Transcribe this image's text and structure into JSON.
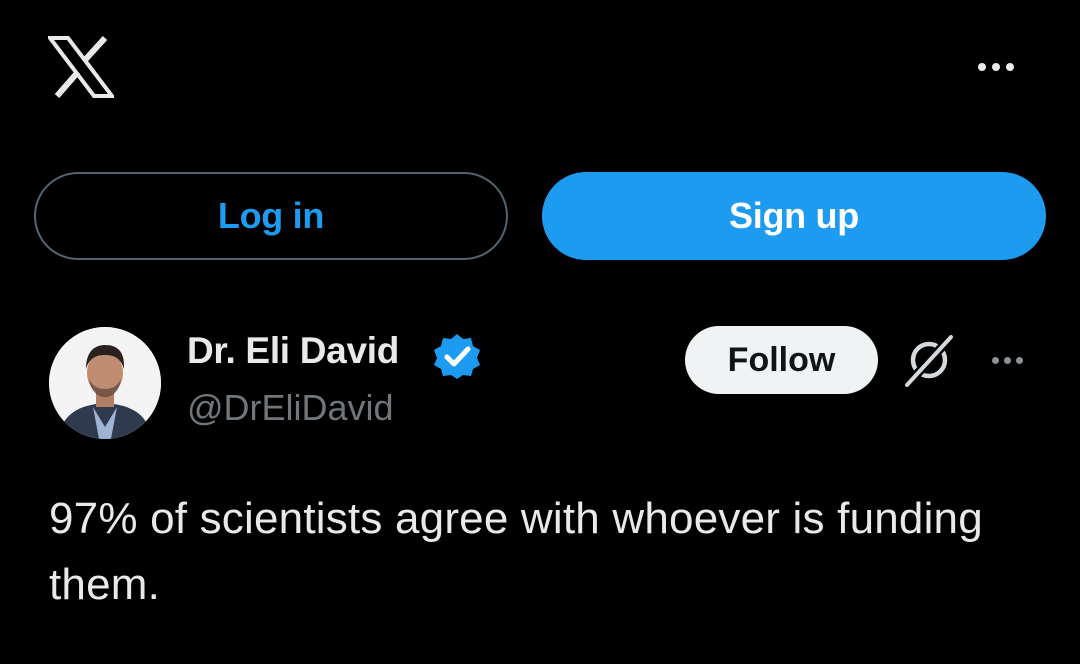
{
  "header": {
    "logo_icon": "x-logo-icon",
    "more_icon": "more-horizontal-icon"
  },
  "auth": {
    "login_label": "Log in",
    "signup_label": "Sign up"
  },
  "post": {
    "author": {
      "name": "Dr. Eli David",
      "handle": "@DrEliDavid",
      "verified_icon": "verified-badge-icon",
      "avatar": "avatar"
    },
    "follow_label": "Follow",
    "grok_icon": "grok-icon",
    "more_icon": "more-horizontal-icon",
    "text": "97% of scientists agree with whoever is funding them."
  },
  "colors": {
    "background": "#000000",
    "accent": "#1d9bf0",
    "text_primary": "#e7e9ea",
    "text_secondary": "#71767b",
    "follow_bg": "#eff3f4",
    "login_border": "#536471"
  }
}
